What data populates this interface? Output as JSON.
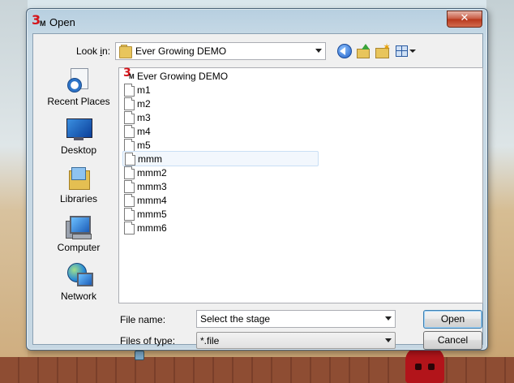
{
  "window": {
    "title": "Open",
    "app_icon": "3m-app-icon",
    "close_icon": "close-icon"
  },
  "lookin": {
    "label": "Look in:",
    "value": "Ever Growing DEMO"
  },
  "toolbar": {
    "back_icon": "back-arrow-icon",
    "up_icon": "up-folder-icon",
    "new_folder_icon": "new-folder-icon",
    "view_icon": "view-menu-icon"
  },
  "places": [
    {
      "label": "Recent Places",
      "icon": "recent-places-icon"
    },
    {
      "label": "Desktop",
      "icon": "desktop-icon"
    },
    {
      "label": "Libraries",
      "icon": "libraries-icon"
    },
    {
      "label": "Computer",
      "icon": "computer-icon"
    },
    {
      "label": "Network",
      "icon": "network-icon"
    }
  ],
  "files": [
    {
      "name": "Ever Growing DEMO",
      "type": "application"
    },
    {
      "name": "m1",
      "type": "file"
    },
    {
      "name": "m2",
      "type": "file"
    },
    {
      "name": "m3",
      "type": "file"
    },
    {
      "name": "m4",
      "type": "file"
    },
    {
      "name": "m5",
      "type": "file"
    },
    {
      "name": "mmm",
      "type": "file",
      "selected": true
    },
    {
      "name": "mmm2",
      "type": "file"
    },
    {
      "name": "mmm3",
      "type": "file"
    },
    {
      "name": "mmm4",
      "type": "file"
    },
    {
      "name": "mmm5",
      "type": "file"
    },
    {
      "name": "mmm6",
      "type": "file"
    }
  ],
  "filename": {
    "label": "File name:",
    "value": "Select the stage"
  },
  "filetype": {
    "label": "Files of type:",
    "value": "*.file"
  },
  "buttons": {
    "open": "Open",
    "cancel": "Cancel"
  }
}
